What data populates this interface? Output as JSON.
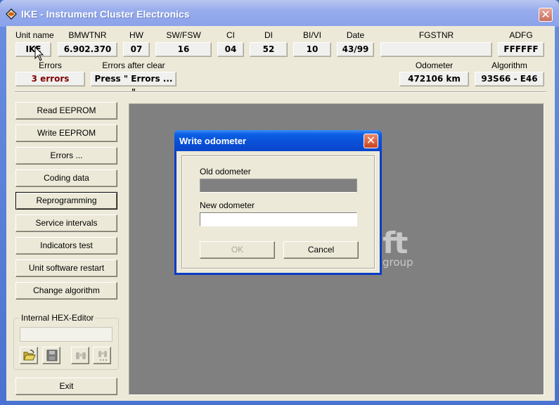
{
  "window": {
    "title": "IKE - Instrument Cluster Electronics",
    "close_glyph": "✕"
  },
  "info": {
    "unit_name": {
      "label": "Unit name",
      "value": "IKE"
    },
    "bmwtnr": {
      "label": "BMWTNR",
      "value": "6.902.370"
    },
    "hw": {
      "label": "HW",
      "value": "07"
    },
    "sw_fsw": {
      "label": "SW/FSW",
      "value": "16"
    },
    "ci": {
      "label": "CI",
      "value": "04"
    },
    "di": {
      "label": "DI",
      "value": "52"
    },
    "bi_vi": {
      "label": "BI/VI",
      "value": "10"
    },
    "date": {
      "label": "Date",
      "value": "43/99"
    },
    "fgstnr": {
      "label": "FGSTNR",
      "value": ""
    },
    "adfg": {
      "label": "ADFG",
      "value": "FFFFFF"
    },
    "errors": {
      "label": "Errors",
      "value": "3 errors"
    },
    "errors_after_clear": {
      "label": "Errors after clear",
      "value": "Press \" Errors ... \""
    },
    "odometer": {
      "label": "Odometer",
      "value": "472106 km"
    },
    "algorithm": {
      "label": "Algorithm",
      "value": "93S66 - E46"
    }
  },
  "colors": {
    "error_text": "#800000",
    "panel_bg": "#808080",
    "dialog_title": "#0a4fd6"
  },
  "sidebar": {
    "buttons": [
      {
        "label": "Read EEPROM"
      },
      {
        "label": "Write EEPROM"
      },
      {
        "label": "Errors ..."
      },
      {
        "label": "Coding data"
      },
      {
        "label": "Reprogramming"
      },
      {
        "label": "Service intervals"
      },
      {
        "label": "Indicators test"
      },
      {
        "label": "Unit software restart"
      },
      {
        "label": "Change algorithm"
      }
    ],
    "hex_editor": {
      "label": "Internal HEX-Editor",
      "value": "",
      "tools": [
        "open-folder-icon",
        "save-disk-icon",
        "find-binoculars-icon",
        "find-next-binoculars-icon"
      ]
    },
    "exit_label": "Exit"
  },
  "panel": {
    "logo_main": "ft",
    "logo_sub": "group"
  },
  "dialog": {
    "title": "Write odometer",
    "close_glyph": "✕",
    "old_label": "Old odometer",
    "old_value": "",
    "new_label": "New odometer",
    "new_value": "",
    "ok_label": "OK",
    "cancel_label": "Cancel"
  }
}
